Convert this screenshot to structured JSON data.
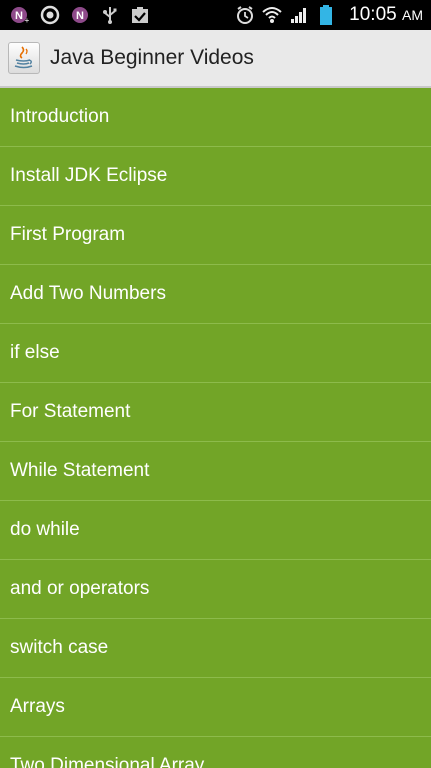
{
  "status_bar": {
    "time": "10:05",
    "ampm": "AM",
    "icons": [
      "onenote-n-icon",
      "record-circle-icon",
      "onenote-n-icon",
      "usb-icon",
      "clipboard-check-icon",
      "alarm-clock-icon",
      "wifi-icon",
      "signal-bars-icon",
      "battery-icon"
    ],
    "colors": {
      "background": "#000000",
      "battery": "#33b5e5"
    }
  },
  "action_bar": {
    "title": "Java Beginner Videos",
    "icon": "java-cup-icon",
    "background": "#e9e9e9"
  },
  "list": {
    "background": "#72a527",
    "items": [
      {
        "label": "Introduction"
      },
      {
        "label": "Install JDK Eclipse"
      },
      {
        "label": "First Program"
      },
      {
        "label": "Add Two Numbers"
      },
      {
        "label": "if else"
      },
      {
        "label": "For Statement"
      },
      {
        "label": "While Statement"
      },
      {
        "label": "do while"
      },
      {
        "label": "and or operators"
      },
      {
        "label": "switch case"
      },
      {
        "label": "Arrays"
      },
      {
        "label": "Two Dimensional Array"
      }
    ]
  }
}
